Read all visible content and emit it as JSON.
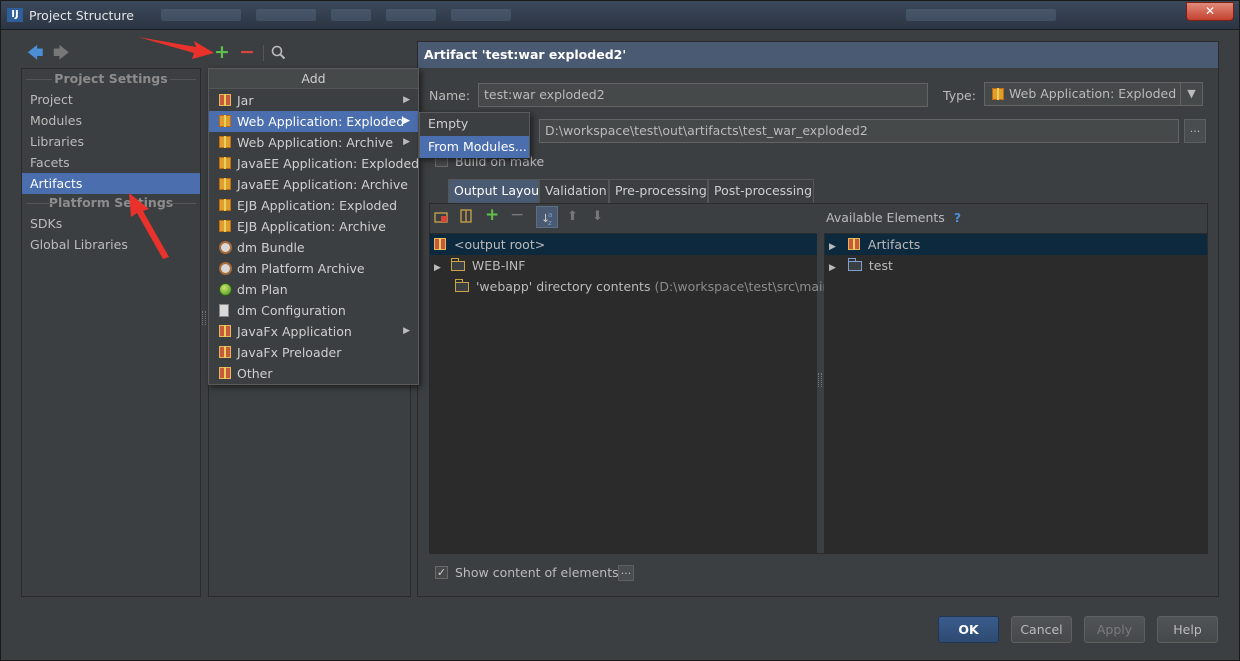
{
  "window": {
    "title": "Project Structure",
    "close_label": "✕"
  },
  "toolbar": {
    "back_icon": "arrow-left-icon",
    "forward_icon": "arrow-right-icon",
    "add_symbol": "+",
    "remove_symbol": "−",
    "search_icon": "magnifier-icon"
  },
  "sidebar": {
    "project_settings_header": "Project Settings",
    "platform_settings_header": "Platform Settings",
    "project_items": [
      "Project",
      "Modules",
      "Libraries",
      "Facets",
      "Artifacts"
    ],
    "platform_items": [
      "SDKs",
      "Global Libraries"
    ],
    "selected": "Artifacts"
  },
  "add_popup": {
    "title": "Add",
    "items": [
      {
        "label": "Jar",
        "icon": "gift-icon",
        "submenu": true
      },
      {
        "label": "Web Application: Exploded",
        "icon": "web-gift-icon",
        "submenu": true,
        "selected": true
      },
      {
        "label": "Web Application: Archive",
        "icon": "web-gift-icon",
        "submenu": true
      },
      {
        "label": "JavaEE Application: Exploded",
        "icon": "web-gift-icon",
        "submenu": false
      },
      {
        "label": "JavaEE Application: Archive",
        "icon": "web-gift-icon",
        "submenu": false
      },
      {
        "label": "EJB Application: Exploded",
        "icon": "web-gift-icon",
        "submenu": false
      },
      {
        "label": "EJB Application: Archive",
        "icon": "web-gift-icon",
        "submenu": false
      },
      {
        "label": "dm Bundle",
        "icon": "bundle-icon",
        "submenu": false
      },
      {
        "label": "dm Platform Archive",
        "icon": "bundle-icon",
        "submenu": false
      },
      {
        "label": "dm Plan",
        "icon": "globe-icon",
        "submenu": false
      },
      {
        "label": "dm Configuration",
        "icon": "document-icon",
        "submenu": false
      },
      {
        "label": "JavaFx Application",
        "icon": "gift-icon",
        "submenu": true
      },
      {
        "label": "JavaFx Preloader",
        "icon": "gift-icon",
        "submenu": false
      },
      {
        "label": "Other",
        "icon": "gift-icon",
        "submenu": false
      }
    ],
    "submenu_arrow": "▶"
  },
  "submenu": {
    "items": [
      "Empty",
      "From Modules..."
    ],
    "selected": "From Modules..."
  },
  "artifact": {
    "header": "Artifact 'test:war exploded2'",
    "name_label": "Name:",
    "name_value": "test:war exploded2",
    "type_label": "Type:",
    "type_value": "Web Application: Exploded",
    "output_dir": "D:\\workspace\\test\\out\\artifacts\\test_war_exploded2",
    "browse_label": "...",
    "build_on_make_label": "Build on make",
    "dropdown_arrow": "▼"
  },
  "tabs": [
    "Output Layout",
    "Validation",
    "Pre-processing",
    "Post-processing"
  ],
  "active_tab": "Output Layout",
  "layout_tree": {
    "rows": [
      {
        "label": "<output root>",
        "icon": "gift-icon",
        "expander": "",
        "selected": true
      },
      {
        "label": "WEB-INF",
        "icon": "folder-icon",
        "expander": "▶",
        "selected": false
      },
      {
        "label": "'webapp' directory contents",
        "hint": "(D:\\workspace\\test\\src\\main)",
        "icon": "folder-icon",
        "expander": "",
        "selected": false
      }
    ]
  },
  "available": {
    "header": "Available Elements",
    "help": "?",
    "rows": [
      {
        "label": "Artifacts",
        "icon": "gift-icon",
        "expander": "▶",
        "selected": true
      },
      {
        "label": "test",
        "icon": "module-folder-icon",
        "expander": "▶",
        "selected": false
      }
    ]
  },
  "show_content": {
    "label": "Show content of elements",
    "checked": true,
    "check_mark": "✓",
    "more_label": "..."
  },
  "buttons": {
    "ok": "OK",
    "cancel": "Cancel",
    "apply": "Apply",
    "help": "Help"
  },
  "colors": {
    "accent": "#4b6eaf",
    "arrow": "#e8322b"
  }
}
